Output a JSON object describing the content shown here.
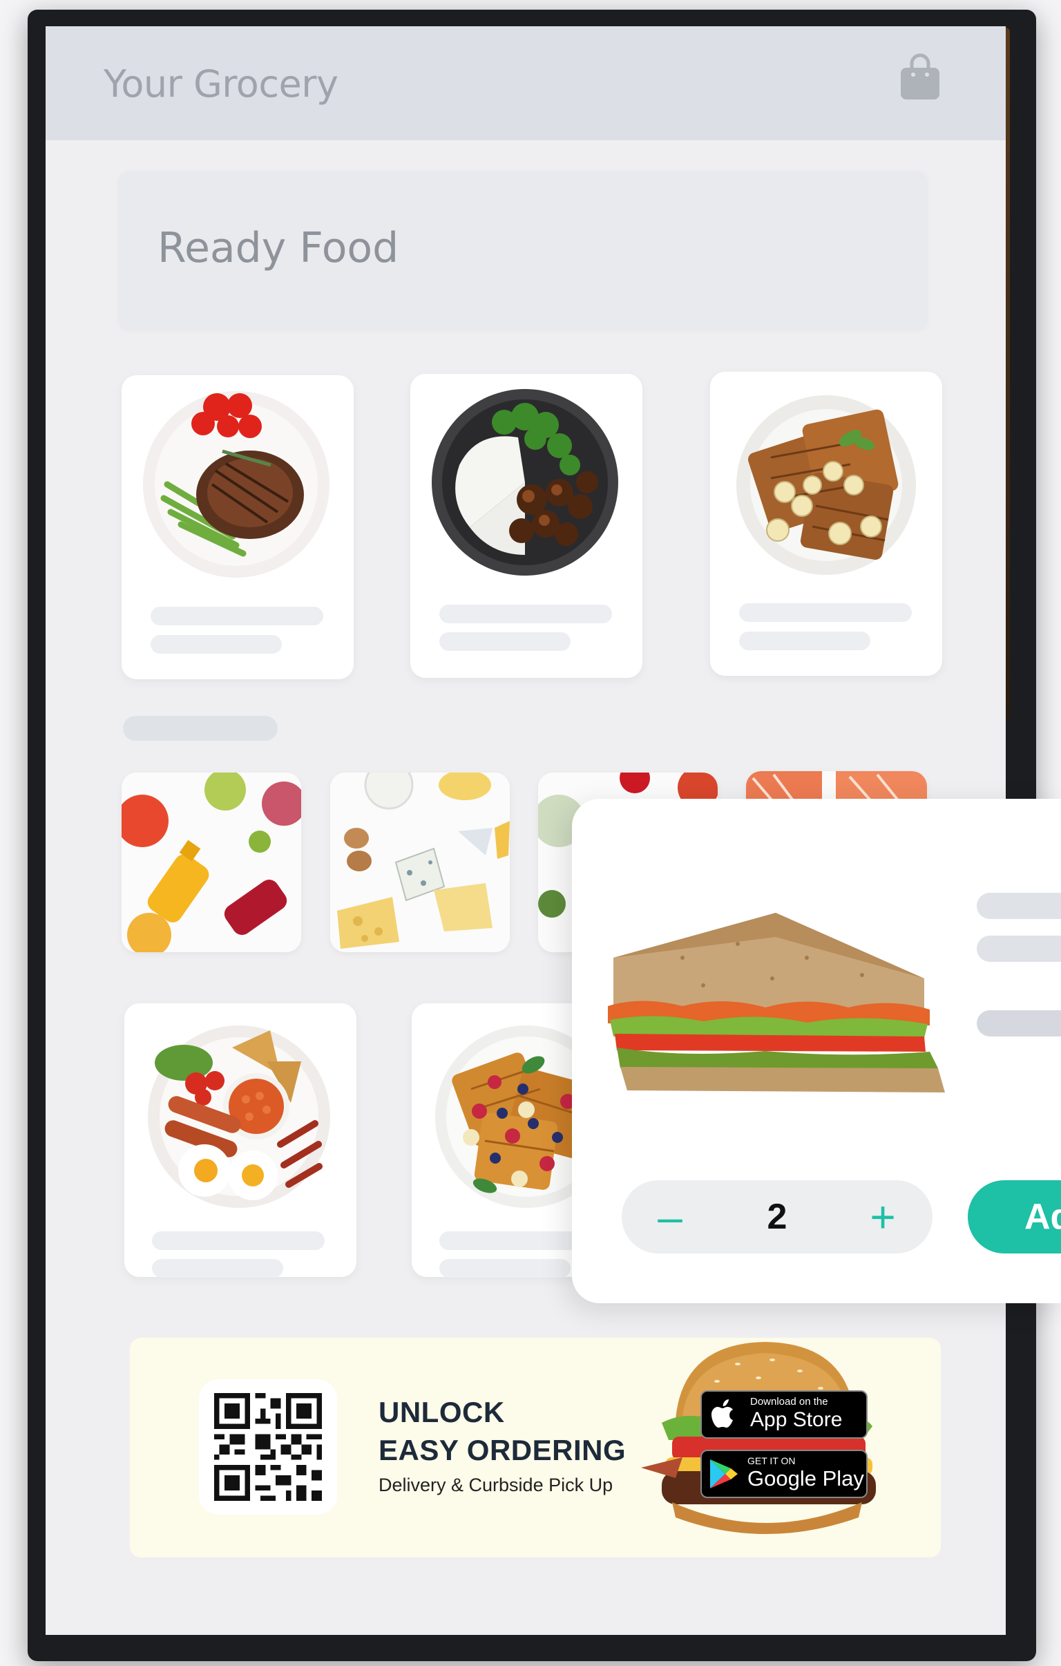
{
  "app": {
    "title": "Your Grocery",
    "cart_icon": "shopping-bag-icon"
  },
  "section": {
    "title": "Ready Food"
  },
  "products_row1": [
    {
      "name": "steak-plate"
    },
    {
      "name": "rice-chicken-bowl"
    },
    {
      "name": "waffle-plate"
    }
  ],
  "categories": [
    {
      "name": "juices"
    },
    {
      "name": "dairy-cheese"
    },
    {
      "name": "vegetables"
    },
    {
      "name": "seafood"
    }
  ],
  "products_row2": [
    {
      "name": "english-breakfast"
    },
    {
      "name": "berry-waffles"
    }
  ],
  "detail": {
    "product": "sandwich",
    "quantity": "2",
    "minus_symbol": "–",
    "plus_symbol": "+",
    "add_label": "Ad"
  },
  "promo": {
    "heading": "UNLOCK\nEASY ORDERING",
    "subtitle": "Delivery & Curbside Pick Up",
    "appstore_small": "Download on the",
    "appstore_big": "App Store",
    "googleplay_small": "GET IT ON",
    "googleplay_big": "Google Play"
  },
  "colors": {
    "accent": "#1ec0a6",
    "topbar": "#dcdfe6",
    "promo_bg": "#fdfbe9"
  }
}
